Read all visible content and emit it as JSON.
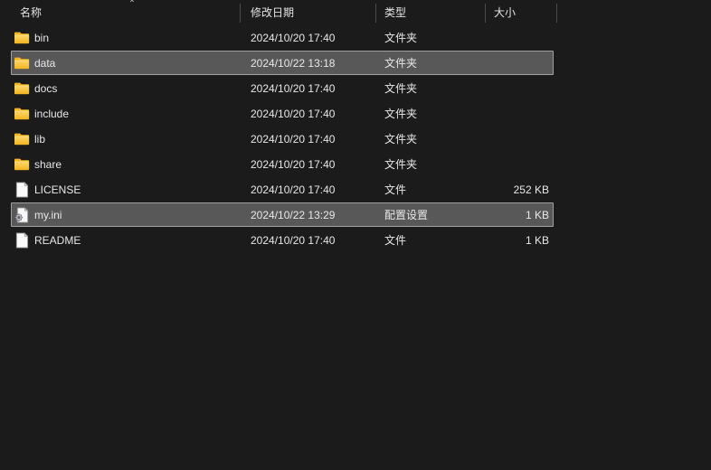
{
  "window": {
    "theme": "dark",
    "background_color": "#1b1b1b",
    "selection_color": "#585858",
    "selection_border_color": "#a0a0a0",
    "folder_icon_color": "#f7c948",
    "file_icon_color": "#f2f2f2"
  },
  "header": {
    "sort_indicator": "⌃",
    "columns": [
      {
        "id": "name",
        "label": "名称"
      },
      {
        "id": "date",
        "label": "修改日期"
      },
      {
        "id": "type",
        "label": "类型"
      },
      {
        "id": "size",
        "label": "大小"
      }
    ]
  },
  "rows": [
    {
      "name": "bin",
      "date": "2024/10/20 17:40",
      "type": "文件夹",
      "size": "",
      "icon": "folder-icon",
      "selected": false
    },
    {
      "name": "data",
      "date": "2024/10/22 13:18",
      "type": "文件夹",
      "size": "",
      "icon": "folder-icon",
      "selected": true
    },
    {
      "name": "docs",
      "date": "2024/10/20 17:40",
      "type": "文件夹",
      "size": "",
      "icon": "folder-icon",
      "selected": false
    },
    {
      "name": "include",
      "date": "2024/10/20 17:40",
      "type": "文件夹",
      "size": "",
      "icon": "folder-icon",
      "selected": false
    },
    {
      "name": "lib",
      "date": "2024/10/20 17:40",
      "type": "文件夹",
      "size": "",
      "icon": "folder-icon",
      "selected": false
    },
    {
      "name": "share",
      "date": "2024/10/20 17:40",
      "type": "文件夹",
      "size": "",
      "icon": "folder-icon",
      "selected": false
    },
    {
      "name": "LICENSE",
      "date": "2024/10/20 17:40",
      "type": "文件",
      "size": "252 KB",
      "icon": "file-icon",
      "selected": false
    },
    {
      "name": "my.ini",
      "date": "2024/10/22 13:29",
      "type": "配置设置",
      "size": "1 KB",
      "icon": "config-file-icon",
      "selected": true
    },
    {
      "name": "README",
      "date": "2024/10/20 17:40",
      "type": "文件",
      "size": "1 KB",
      "icon": "file-icon",
      "selected": false
    }
  ]
}
